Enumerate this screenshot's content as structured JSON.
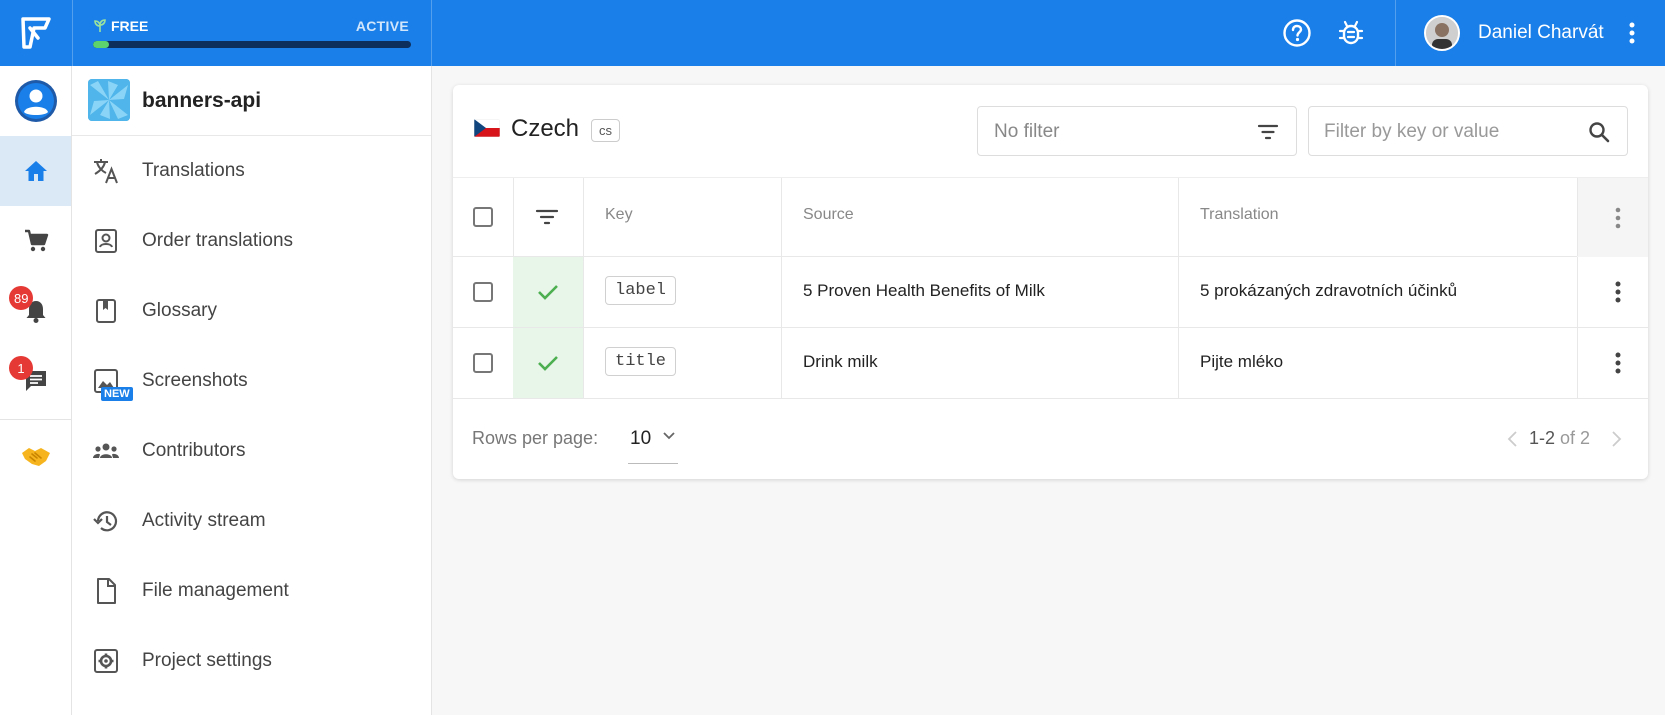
{
  "app": {
    "plan": {
      "name": "FREE",
      "status": "ACTIVE",
      "progress": 0.05
    },
    "user": {
      "name": "Daniel Charvát"
    },
    "colors": {
      "brand": "#1a7fe8",
      "success": "#4caf50",
      "badge": "#e53935"
    }
  },
  "rail": {
    "notifications_count": "89",
    "messages_count": "1"
  },
  "sidebar": {
    "project_name": "banners-api",
    "items": [
      {
        "label": "Translations",
        "icon": "translate-icon"
      },
      {
        "label": "Order translations",
        "icon": "order-icon"
      },
      {
        "label": "Glossary",
        "icon": "book-icon"
      },
      {
        "label": "Screenshots",
        "icon": "image-icon",
        "badge": "NEW"
      },
      {
        "label": "Contributors",
        "icon": "group-icon"
      },
      {
        "label": "Activity stream",
        "icon": "history-icon"
      },
      {
        "label": "File management",
        "icon": "file-icon"
      },
      {
        "label": "Project settings",
        "icon": "settings-icon"
      }
    ]
  },
  "main": {
    "language": {
      "name": "Czech",
      "code": "cs"
    },
    "filter": {
      "value": "No filter"
    },
    "search": {
      "placeholder": "Filter by key or value"
    },
    "table": {
      "columns": {
        "key": "Key",
        "source": "Source",
        "translation": "Translation"
      },
      "rows": [
        {
          "key": "label",
          "source": "5 Proven Health Benefits of Milk",
          "translation": "5 prokázaných zdravotních účinků"
        },
        {
          "key": "title",
          "source": "Drink milk",
          "translation": "Pijte mléko"
        }
      ]
    },
    "pagination": {
      "rows_per_page_label": "Rows per page:",
      "rows_per_page": "10",
      "range": "1-2",
      "of_label": "of 2"
    }
  }
}
